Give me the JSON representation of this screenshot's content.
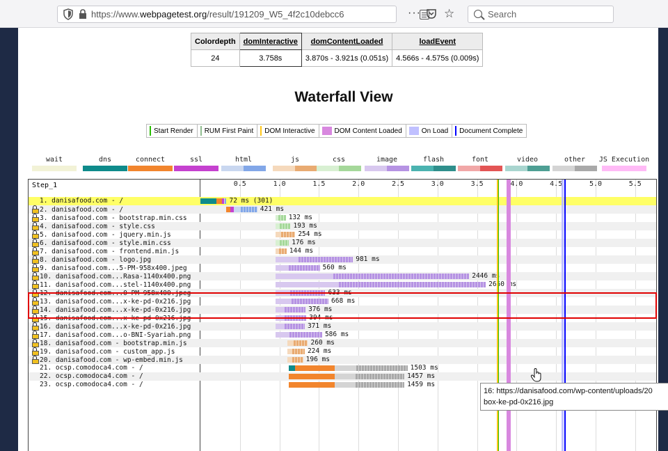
{
  "browser": {
    "url_prefix": "https://www.",
    "url_host": "webpagetest.org",
    "url_rest": "/result/191209_W5_4f2c10debcc6",
    "search_placeholder": "Search",
    "ellipsis": "···"
  },
  "timing_table": {
    "headers": [
      "Colordepth",
      "domInteractive",
      "domContentLoaded",
      "loadEvent"
    ],
    "values": [
      "24",
      "3.758s",
      "3.870s - 3.921s (0.051s)",
      "4.566s - 4.575s (0.009s)"
    ]
  },
  "waterfall_title": "Waterfall View",
  "marker_legend": [
    {
      "label": "Start Render",
      "color": "#28bc00",
      "kind": "line"
    },
    {
      "label": "RUM First Paint",
      "color": "#8fbc8f",
      "kind": "line"
    },
    {
      "label": "DOM Interactive",
      "color": "#ffc61a",
      "kind": "line"
    },
    {
      "label": "DOM Content Loaded",
      "color": "#d888df",
      "kind": "box"
    },
    {
      "label": "On Load",
      "color": "#c0c0ff",
      "kind": "box"
    },
    {
      "label": "Document Complete",
      "color": "#0000ff",
      "kind": "line"
    }
  ],
  "type_legend": [
    {
      "label": "wait",
      "c1": "#f2f2d6",
      "c2": "#f2f2d6"
    },
    {
      "label": "dns",
      "c1": "#0e8b8b",
      "c2": "#0e8b8b"
    },
    {
      "label": "connect",
      "c1": "#f2852d",
      "c2": "#f2852d"
    },
    {
      "label": "ssl",
      "c1": "#c541cf",
      "c2": "#c541cf"
    },
    {
      "label": "html",
      "c1": "#c9d7f0",
      "c2": "#82a7e8"
    },
    {
      "label": "js",
      "c1": "#f5d9bc",
      "c2": "#e9ab72"
    },
    {
      "label": "css",
      "c1": "#d8f0d2",
      "c2": "#a5d89a"
    },
    {
      "label": "image",
      "c1": "#d8c8ef",
      "c2": "#b693e3"
    },
    {
      "label": "flash",
      "c1": "#4bb3b0",
      "c2": "#2f8f8c"
    },
    {
      "label": "font",
      "c1": "#f1a7a7",
      "c2": "#e35555"
    },
    {
      "label": "video",
      "c1": "#a9d5cf",
      "c2": "#4e9f94"
    },
    {
      "label": "other",
      "c1": "#d4d4d4",
      "c2": "#a9a9a9"
    },
    {
      "label": "JS Execution",
      "c1": "#ffbaf6",
      "c2": "#ffbaf6"
    }
  ],
  "waterfall": {
    "step_label": "Step_1",
    "ticks": [
      "0.5",
      "1.0",
      "1.5",
      "2.0",
      "2.5",
      "3.0",
      "3.5",
      "4.0",
      "4.5",
      "5.0",
      "5.5"
    ],
    "markers": {
      "start_render": 3.76,
      "dom_interactive": 3.758,
      "dom_content_loaded": [
        3.87,
        3.921
      ],
      "on_load": [
        4.566,
        4.575
      ],
      "document_complete": 4.6
    },
    "rows": [
      {
        "label": "1. danisafood.com - /",
        "duration": "72 ms (301)",
        "secure": false,
        "type": "html",
        "start": 0.0,
        "end": 0.33,
        "prefix": [
          [
            "dns",
            0.0,
            0.2
          ],
          [
            "connect",
            0.2,
            0.27
          ],
          [
            "ssl",
            0.27,
            0.3
          ]
        ]
      },
      {
        "label": "2. danisafood.com - /",
        "duration": "421 ms",
        "secure": true,
        "type": "html",
        "start": 0.33,
        "end": 0.72,
        "prefix": [
          [
            "connect",
            0.33,
            0.38
          ],
          [
            "ssl",
            0.38,
            0.42
          ]
        ]
      },
      {
        "label": "3. danisafood.com - bootstrap.min.css",
        "duration": "132 ms",
        "secure": true,
        "type": "css",
        "start": 0.95,
        "end": 1.08,
        "prefix": []
      },
      {
        "label": "4. danisafood.com - style.css",
        "duration": "193 ms",
        "secure": true,
        "type": "css",
        "start": 0.95,
        "end": 1.14,
        "prefix": []
      },
      {
        "label": "5. danisafood.com - jquery.min.js",
        "duration": "254 ms",
        "secure": true,
        "type": "js",
        "start": 0.95,
        "end": 1.2,
        "prefix": []
      },
      {
        "label": "6. danisafood.com - style.min.css",
        "duration": "176 ms",
        "secure": true,
        "type": "css",
        "start": 0.95,
        "end": 1.12,
        "prefix": []
      },
      {
        "label": "7. danisafood.com - frontend.min.js",
        "duration": "144 ms",
        "secure": true,
        "type": "js",
        "start": 0.95,
        "end": 1.09,
        "prefix": []
      },
      {
        "label": "8. danisafood.com - logo.jpg",
        "duration": "981 ms",
        "secure": true,
        "type": "image",
        "start": 0.95,
        "end": 1.93,
        "prefix": []
      },
      {
        "label": "9. danisafood.com...5-PM-958x400.jpeg",
        "duration": "560 ms",
        "secure": true,
        "type": "image",
        "start": 0.95,
        "end": 1.51,
        "prefix": []
      },
      {
        "label": "10. danisafood.com...Rasa-1140x400.png",
        "duration": "2446 ms",
        "secure": true,
        "type": "image",
        "start": 0.95,
        "end": 3.4,
        "prefix": []
      },
      {
        "label": "11. danisafood.com...stel-1140x400.png",
        "duration": "2660 ms",
        "secure": true,
        "type": "image",
        "start": 0.95,
        "end": 3.61,
        "prefix": []
      },
      {
        "label": "12. danisafood.com...0-PM-958x400.jpeg",
        "duration": "633 ms",
        "secure": true,
        "type": "image",
        "start": 0.95,
        "end": 1.58,
        "prefix": []
      },
      {
        "label": "13. danisafood.com...x-ke-pd-0x216.jpg",
        "duration": "668 ms",
        "secure": true,
        "type": "image",
        "start": 0.95,
        "end": 1.62,
        "prefix": []
      },
      {
        "label": "14. danisafood.com...x-ke-pd-0x216.jpg",
        "duration": "376 ms",
        "secure": true,
        "type": "image",
        "start": 0.95,
        "end": 1.33,
        "prefix": []
      },
      {
        "label": "15. danisafood.com...x-ke-pd-0x216.jpg",
        "duration": "394 ms",
        "secure": true,
        "type": "image",
        "start": 0.95,
        "end": 1.34,
        "prefix": []
      },
      {
        "label": "16. danisafood.com...x-ke-pd-0x216.jpg",
        "duration": "371 ms",
        "secure": true,
        "type": "image",
        "start": 0.95,
        "end": 1.32,
        "prefix": []
      },
      {
        "label": "17. danisafood.com...o-BNI-Syariah.png",
        "duration": "586 ms",
        "secure": true,
        "type": "image",
        "start": 0.95,
        "end": 1.54,
        "prefix": []
      },
      {
        "label": "18. danisafood.com - bootstrap.min.js",
        "duration": "260 ms",
        "secure": true,
        "type": "js",
        "start": 1.1,
        "end": 1.36,
        "prefix": []
      },
      {
        "label": "19. danisafood.com - custom_app.js",
        "duration": "224 ms",
        "secure": true,
        "type": "js",
        "start": 1.1,
        "end": 1.32,
        "prefix": []
      },
      {
        "label": "20. danisafood.com - wp-embed.min.js",
        "duration": "196 ms",
        "secure": true,
        "type": "js",
        "start": 1.1,
        "end": 1.3,
        "prefix": []
      },
      {
        "label": "21. ocsp.comodoca4.com - /",
        "duration": "1503 ms",
        "secure": false,
        "type": "other",
        "start": 1.12,
        "end": 2.62,
        "prefix": [
          [
            "dns",
            1.12,
            1.2
          ],
          [
            "connect",
            1.2,
            1.7
          ]
        ]
      },
      {
        "label": "22. ocsp.comodoca4.com - /",
        "duration": "1457 ms",
        "secure": false,
        "type": "other",
        "start": 1.12,
        "end": 2.58,
        "prefix": [
          [
            "connect",
            1.12,
            1.7
          ]
        ]
      },
      {
        "label": "23. ocsp.comodoca4.com - /",
        "duration": "1459 ms",
        "secure": false,
        "type": "other",
        "start": 1.12,
        "end": 2.58,
        "prefix": [
          [
            "connect",
            1.12,
            1.7
          ]
        ]
      }
    ]
  },
  "tooltip": {
    "line1": "16: https://danisafood.com/wp-content/uploads/20",
    "line2": "box-ke-pd-0x216.jpg"
  }
}
